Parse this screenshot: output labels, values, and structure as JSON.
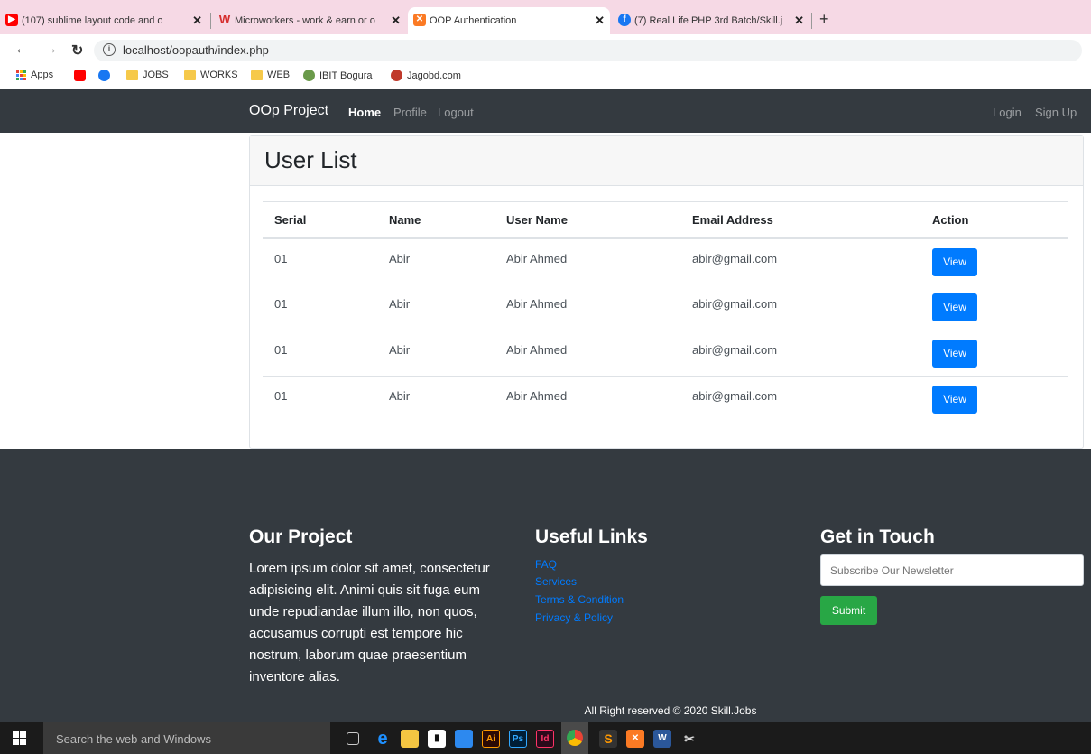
{
  "browser": {
    "tabs": [
      {
        "title": "(107) sublime layout code and o",
        "favicon": "youtube-icon",
        "color": "#ff0000"
      },
      {
        "title": "Microworkers - work & earn or o",
        "favicon": "microworkers-icon",
        "color": "#d62e2e"
      },
      {
        "title": "OOP Authentication",
        "favicon": "xampp-icon",
        "color": "#fb7a24"
      },
      {
        "title": "(7) Real Life PHP 3rd Batch/Skill.j",
        "favicon": "facebook-icon",
        "color": "#1877f2"
      }
    ],
    "new_tab": "+",
    "url": "localhost/oopauth/index.php",
    "bookmarks": [
      {
        "label": "Apps",
        "icon": "apps-grid-icon"
      },
      {
        "label": "",
        "icon": "youtube-icon"
      },
      {
        "label": "",
        "icon": "facebook-icon"
      },
      {
        "label": "JOBS",
        "icon": "folder-icon"
      },
      {
        "label": "WORKS",
        "icon": "folder-icon"
      },
      {
        "label": "WEB",
        "icon": "folder-icon"
      },
      {
        "label": "IBIT Bogura",
        "icon": "site-icon"
      },
      {
        "label": "Jagobd.com",
        "icon": "site-icon"
      }
    ]
  },
  "navbar": {
    "brand": "OOp Project",
    "links": [
      "Home",
      "Profile",
      "Logout"
    ],
    "right_links": [
      "Login",
      "Sign Up"
    ]
  },
  "main": {
    "title": "User List",
    "columns": [
      "Serial",
      "Name",
      "User Name",
      "Email Address",
      "Action"
    ],
    "rows": [
      {
        "serial": "01",
        "name": "Abir",
        "username": "Abir Ahmed",
        "email": "abir@gmail.com",
        "action": "View"
      },
      {
        "serial": "01",
        "name": "Abir",
        "username": "Abir Ahmed",
        "email": "abir@gmail.com",
        "action": "View"
      },
      {
        "serial": "01",
        "name": "Abir",
        "username": "Abir Ahmed",
        "email": "abir@gmail.com",
        "action": "View"
      },
      {
        "serial": "01",
        "name": "Abir",
        "username": "Abir Ahmed",
        "email": "abir@gmail.com",
        "action": "View"
      }
    ]
  },
  "footer": {
    "about_heading": "Our Project",
    "about_text": "Lorem ipsum dolor sit amet, consectetur adipisicing elit. Animi quis sit fuga eum unde repudiandae illum illo, non quos, accusamus corrupti est tempore hic nostrum, laborum quae praesentium inventore alias.",
    "links_heading": "Useful Links",
    "links": [
      "FAQ",
      "Services",
      "Terms & Condition",
      "Privacy & Policy"
    ],
    "contact_heading": "Get in Touch",
    "newsletter_placeholder": "Subscribe Our Newsletter",
    "submit_label": "Submit",
    "copyright": "All Right reserved © 2020 Skill.Jobs"
  },
  "taskbar": {
    "search_placeholder": "Search the web and Windows"
  },
  "colors": {
    "navbar_bg": "#343a40",
    "primary": "#007bff",
    "success": "#28a745",
    "tabbar_bg": "#f6d9e5"
  }
}
